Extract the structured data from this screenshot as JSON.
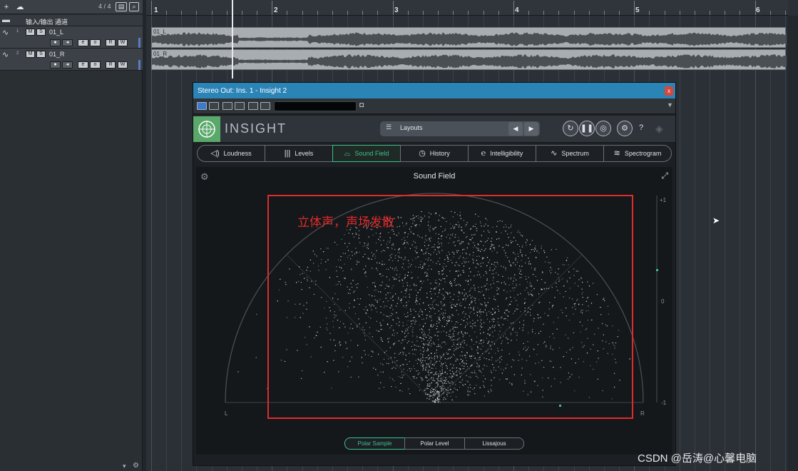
{
  "track_panel": {
    "toolbar": {
      "add_label": "+",
      "count": "4 / 4"
    },
    "folder": {
      "name": "输入/输出 通道"
    },
    "tracks": [
      {
        "num": "1",
        "name": "01_L",
        "m": "M",
        "s": "S",
        "r": "R",
        "w": "W"
      },
      {
        "num": "2",
        "name": "01_R",
        "m": "M",
        "s": "S",
        "r": "R",
        "w": "W"
      }
    ]
  },
  "ruler": {
    "bars": [
      "1",
      "2",
      "3",
      "4",
      "5",
      "6"
    ]
  },
  "events": [
    {
      "label": "01_L"
    },
    {
      "label": "01_R"
    }
  ],
  "plugin": {
    "title": "Stereo Out: Ins. 1 - Insight 2",
    "close": "x",
    "logo_text": "INSIGHT",
    "layouts_label": "Layouts",
    "tabs": [
      {
        "label": "Loudness",
        "icon": "speaker-icon"
      },
      {
        "label": "Levels",
        "icon": "levels-icon"
      },
      {
        "label": "Sound Field",
        "icon": "sound-field-icon"
      },
      {
        "label": "History",
        "icon": "history-icon"
      },
      {
        "label": "Intelligibility",
        "icon": "ear-icon"
      },
      {
        "label": "Spectrum",
        "icon": "spectrum-icon"
      },
      {
        "label": "Spectrogram",
        "icon": "spectrogram-icon"
      }
    ],
    "active_tab": "Sound Field",
    "field_title": "Sound Field",
    "scale": {
      "top": "+1",
      "mid": "0",
      "bottom": "-1",
      "left": "L",
      "right": "R"
    },
    "annotation": "立体声，声场发散",
    "modes": [
      {
        "label": "Polar Sample"
      },
      {
        "label": "Polar Level"
      },
      {
        "label": "Lissajous"
      }
    ],
    "active_mode": "Polar Sample",
    "accent_color": "#3fbf8a",
    "annotation_color": "#e02b2b"
  },
  "watermark": "CSDN @岳涛@心馨电脑"
}
